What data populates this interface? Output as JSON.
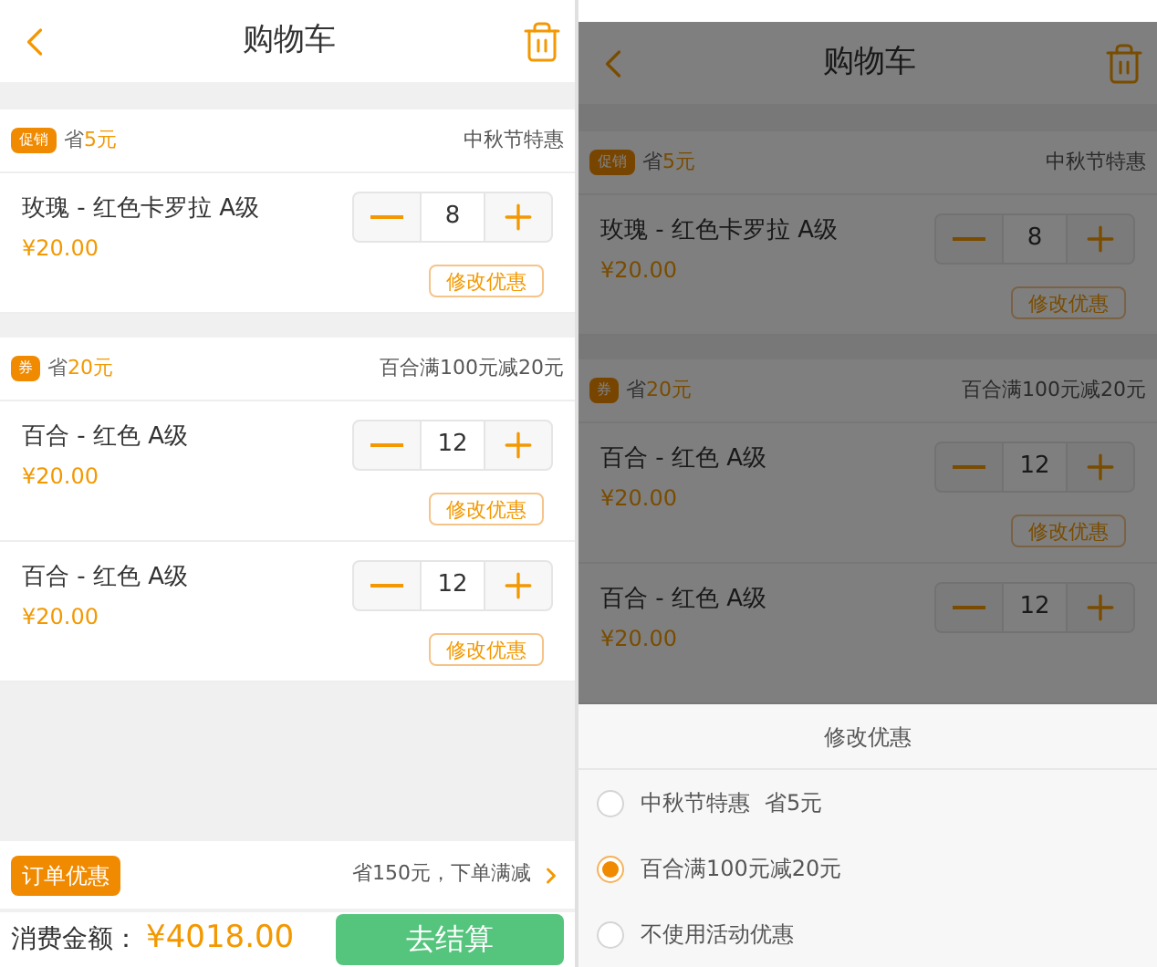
{
  "screens": [
    {
      "header": {
        "title": "购物车"
      },
      "groups": [
        {
          "kind": "promo",
          "tag": "促销",
          "saving_label": "省",
          "saving_amount": "5元",
          "name": "中秋节特惠",
          "items": [
            {
              "name": "玫瑰 - 红色卡罗拉 A级",
              "price": "¥20.00",
              "qty": "8",
              "edit_label": "修改优惠"
            }
          ]
        },
        {
          "kind": "coupon",
          "tag": "券",
          "saving_label": "省",
          "saving_amount": "20元",
          "name": "百合满100元减20元",
          "items": [
            {
              "name": "百合 - 红色 A级",
              "price": "¥20.00",
              "qty": "12",
              "edit_label": "修改优惠"
            },
            {
              "name": "百合 - 红色 A级",
              "price": "¥20.00",
              "qty": "12",
              "edit_label": "修改优惠"
            }
          ]
        }
      ],
      "order_discount": {
        "tag": "订单优惠",
        "text": "省150元，下单满减"
      },
      "footer": {
        "label": "消费金额：",
        "total": "¥4018.00",
        "button": "去结算"
      }
    },
    {
      "header": {
        "title": "购物车"
      },
      "groups": [
        {
          "kind": "promo",
          "tag": "促销",
          "saving_label": "省",
          "saving_amount": "5元",
          "name": "中秋节特惠",
          "items": [
            {
              "name": "玫瑰 - 红色卡罗拉 A级",
              "price": "¥20.00",
              "qty": "8",
              "edit_label": "修改优惠"
            }
          ]
        },
        {
          "kind": "coupon",
          "tag": "券",
          "saving_label": "省",
          "saving_amount": "20元",
          "name": "百合满100元减20元",
          "items": [
            {
              "name": "百合 - 红色 A级",
              "price": "¥20.00",
              "qty": "12",
              "edit_label": "修改优惠"
            },
            {
              "name": "百合 - 红色 A级",
              "price": "¥20.00",
              "qty": "12"
            }
          ]
        }
      ],
      "sheet": {
        "title": "修改优惠",
        "options": [
          {
            "label": "中秋节特惠",
            "note": "省5元",
            "selected": false
          },
          {
            "label": "百合满100元减20元",
            "selected": true
          },
          {
            "label": "不使用活动优惠",
            "selected": false
          }
        ]
      }
    }
  ]
}
